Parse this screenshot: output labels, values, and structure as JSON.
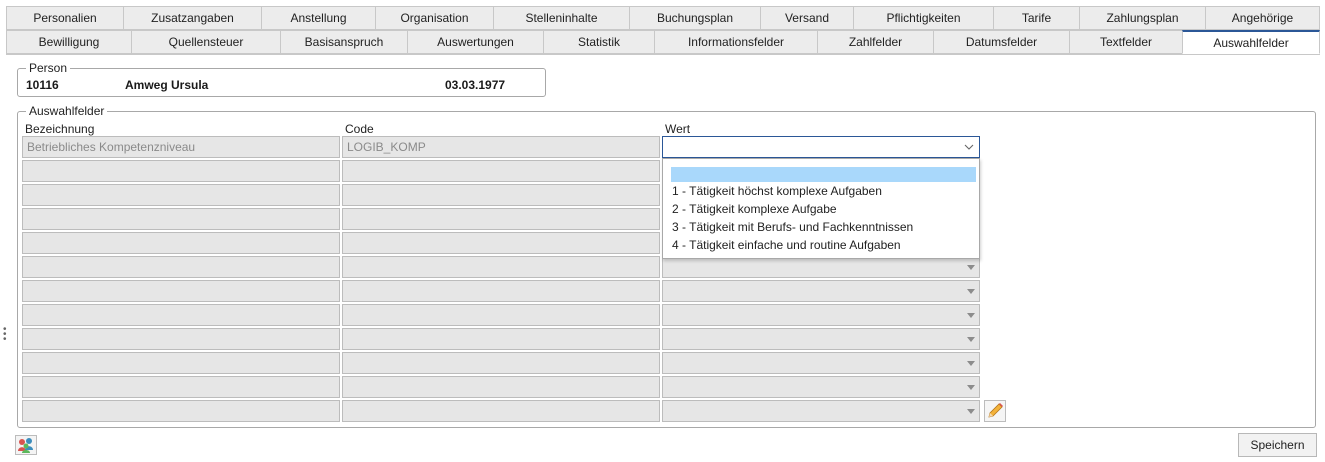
{
  "tabs_row1": [
    "Personalien",
    "Zusatzangaben",
    "Anstellung",
    "Organisation",
    "Stelleninhalte",
    "Buchungsplan",
    "Versand",
    "Pflichtigkeiten",
    "Tarife",
    "Zahlungsplan",
    "Angehörige"
  ],
  "tabs_row2": [
    "Bewilligung",
    "Quellensteuer",
    "Basisanspruch",
    "Auswertungen",
    "Statistik",
    "Informationsfelder",
    "Zahlfelder",
    "Datumsfelder",
    "Textfelder",
    "Auswahlfelder"
  ],
  "active_tab": "Auswahlfelder",
  "person": {
    "legend": "Person",
    "number": "10116",
    "name": "Amweg Ursula",
    "birthdate": "03.03.1977"
  },
  "auswahlfelder": {
    "legend": "Auswahlfelder",
    "col_bezeichnung": "Bezeichnung",
    "col_code": "Code",
    "col_wert": "Wert",
    "rows": [
      {
        "bezeichnung": "Betriebliches Kompetenzniveau",
        "code": "LOGIB_KOMP",
        "wert": ""
      },
      {
        "bezeichnung": "",
        "code": "",
        "wert": ""
      },
      {
        "bezeichnung": "",
        "code": "",
        "wert": ""
      },
      {
        "bezeichnung": "",
        "code": "",
        "wert": ""
      },
      {
        "bezeichnung": "",
        "code": "",
        "wert": ""
      },
      {
        "bezeichnung": "",
        "code": "",
        "wert": ""
      },
      {
        "bezeichnung": "",
        "code": "",
        "wert": ""
      },
      {
        "bezeichnung": "",
        "code": "",
        "wert": ""
      },
      {
        "bezeichnung": "",
        "code": "",
        "wert": ""
      },
      {
        "bezeichnung": "",
        "code": "",
        "wert": ""
      },
      {
        "bezeichnung": "",
        "code": "",
        "wert": ""
      },
      {
        "bezeichnung": "",
        "code": "",
        "wert": ""
      }
    ],
    "dropdown_options": [
      "1 - Tätigkeit höchst komplexe Aufgaben",
      "2 - Tätigkeit komplexe Aufgabe",
      "3 - Tätigkeit mit Berufs- und Fachkenntnissen",
      "4 - Tätigkeit einfache und routine Aufgaben"
    ]
  },
  "buttons": {
    "save": "Speichern"
  },
  "icons": {
    "edit": "pencil-icon",
    "group": "people-icon",
    "splitter": "vertical-dots-icon",
    "dropdown": "chevron-down-icon"
  },
  "colors": {
    "accent": "#2b5797",
    "selection": "#a9d8fb",
    "disabled_field": "#e6e6e6"
  }
}
